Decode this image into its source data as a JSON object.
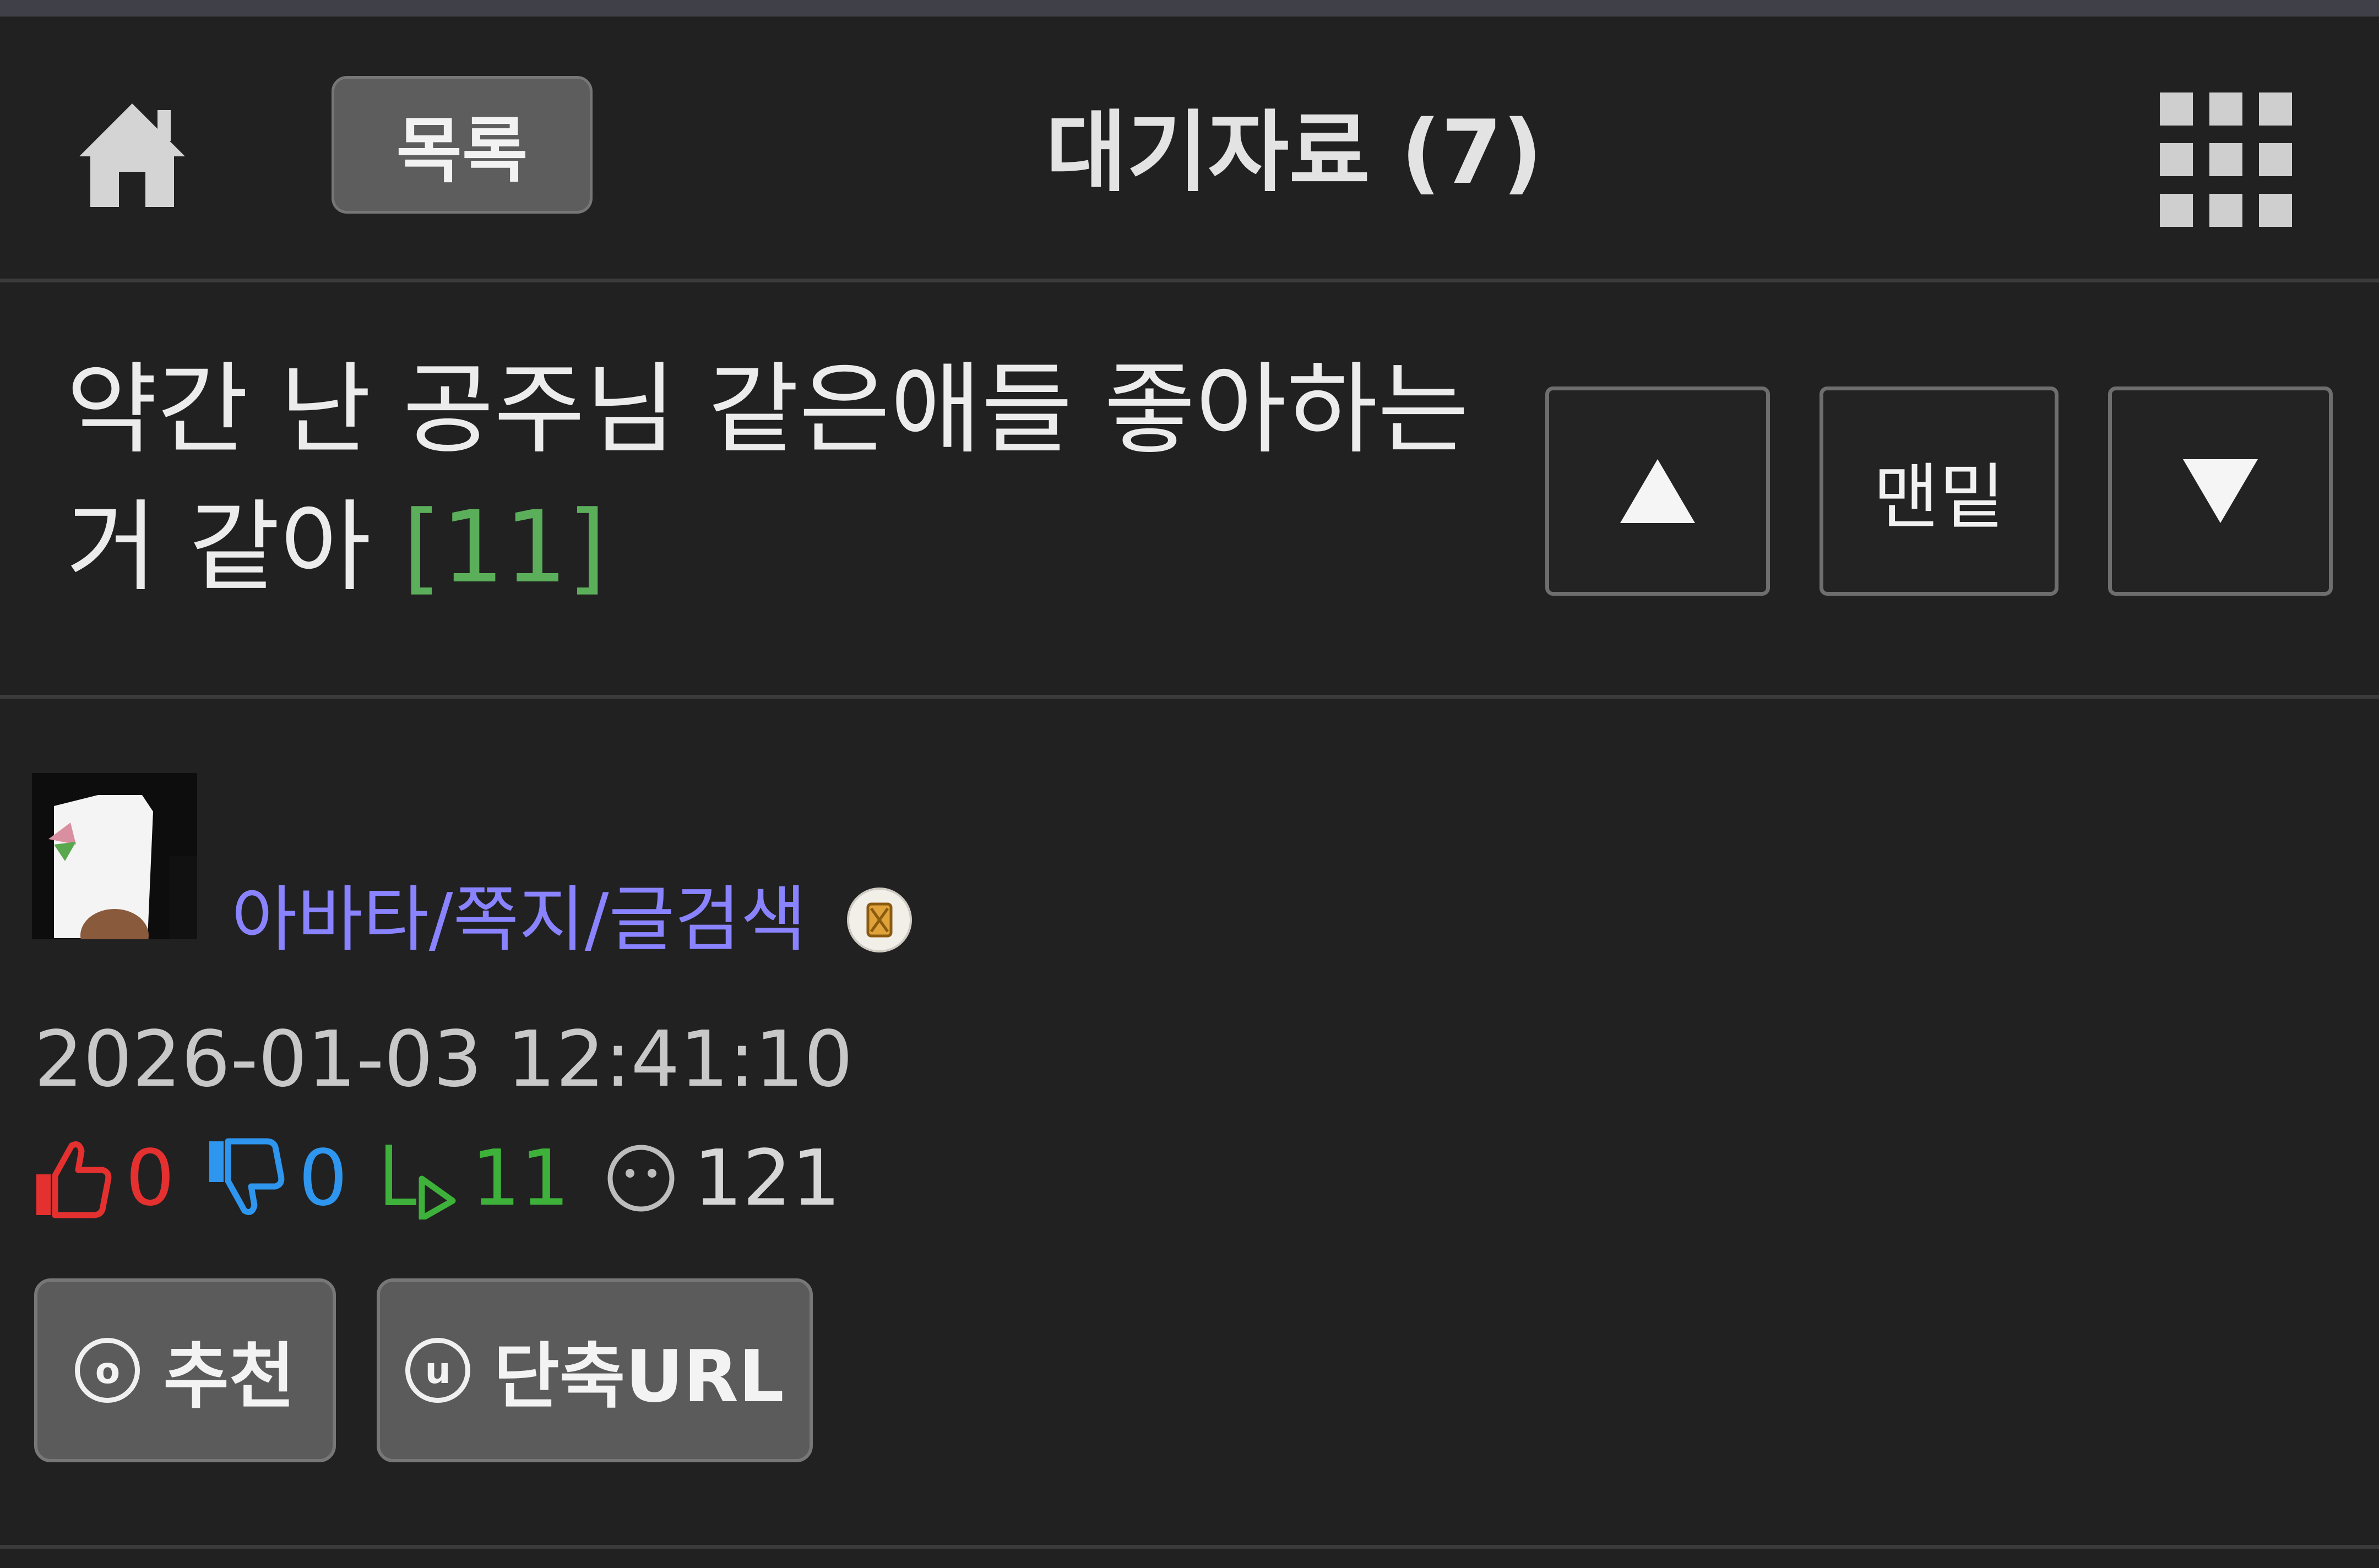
{
  "header": {
    "home_icon": "home-icon",
    "list_label": "목록",
    "title": "대기자료 (7)",
    "menu_icon": "grid-menu-icon"
  },
  "post": {
    "title_text": "약간 난 공주님 같은애들 좋아하는거 같아",
    "comment_count": "[11]",
    "nav": {
      "up_icon": "triangle-up-icon",
      "bottom_label": "맨밑",
      "down_icon": "triangle-down-icon"
    },
    "author": {
      "links_label": "아바타/쪽지/글검색",
      "level_icon": "level-badge-icon"
    },
    "date": "2026-01-03 12:41:10",
    "stats": {
      "likes": "0",
      "dislikes": "0",
      "replies": "11",
      "views": "121"
    },
    "actions": {
      "recommend_key": "o",
      "recommend_label": "추천",
      "shorturl_key": "u",
      "shorturl_label": "단축URL"
    }
  },
  "colors": {
    "background": "#212121",
    "link": "#8a83ff",
    "comment_count": "#5caf5a",
    "like": "#e53030",
    "dislike": "#2e96ee",
    "reply": "#3db13a"
  }
}
